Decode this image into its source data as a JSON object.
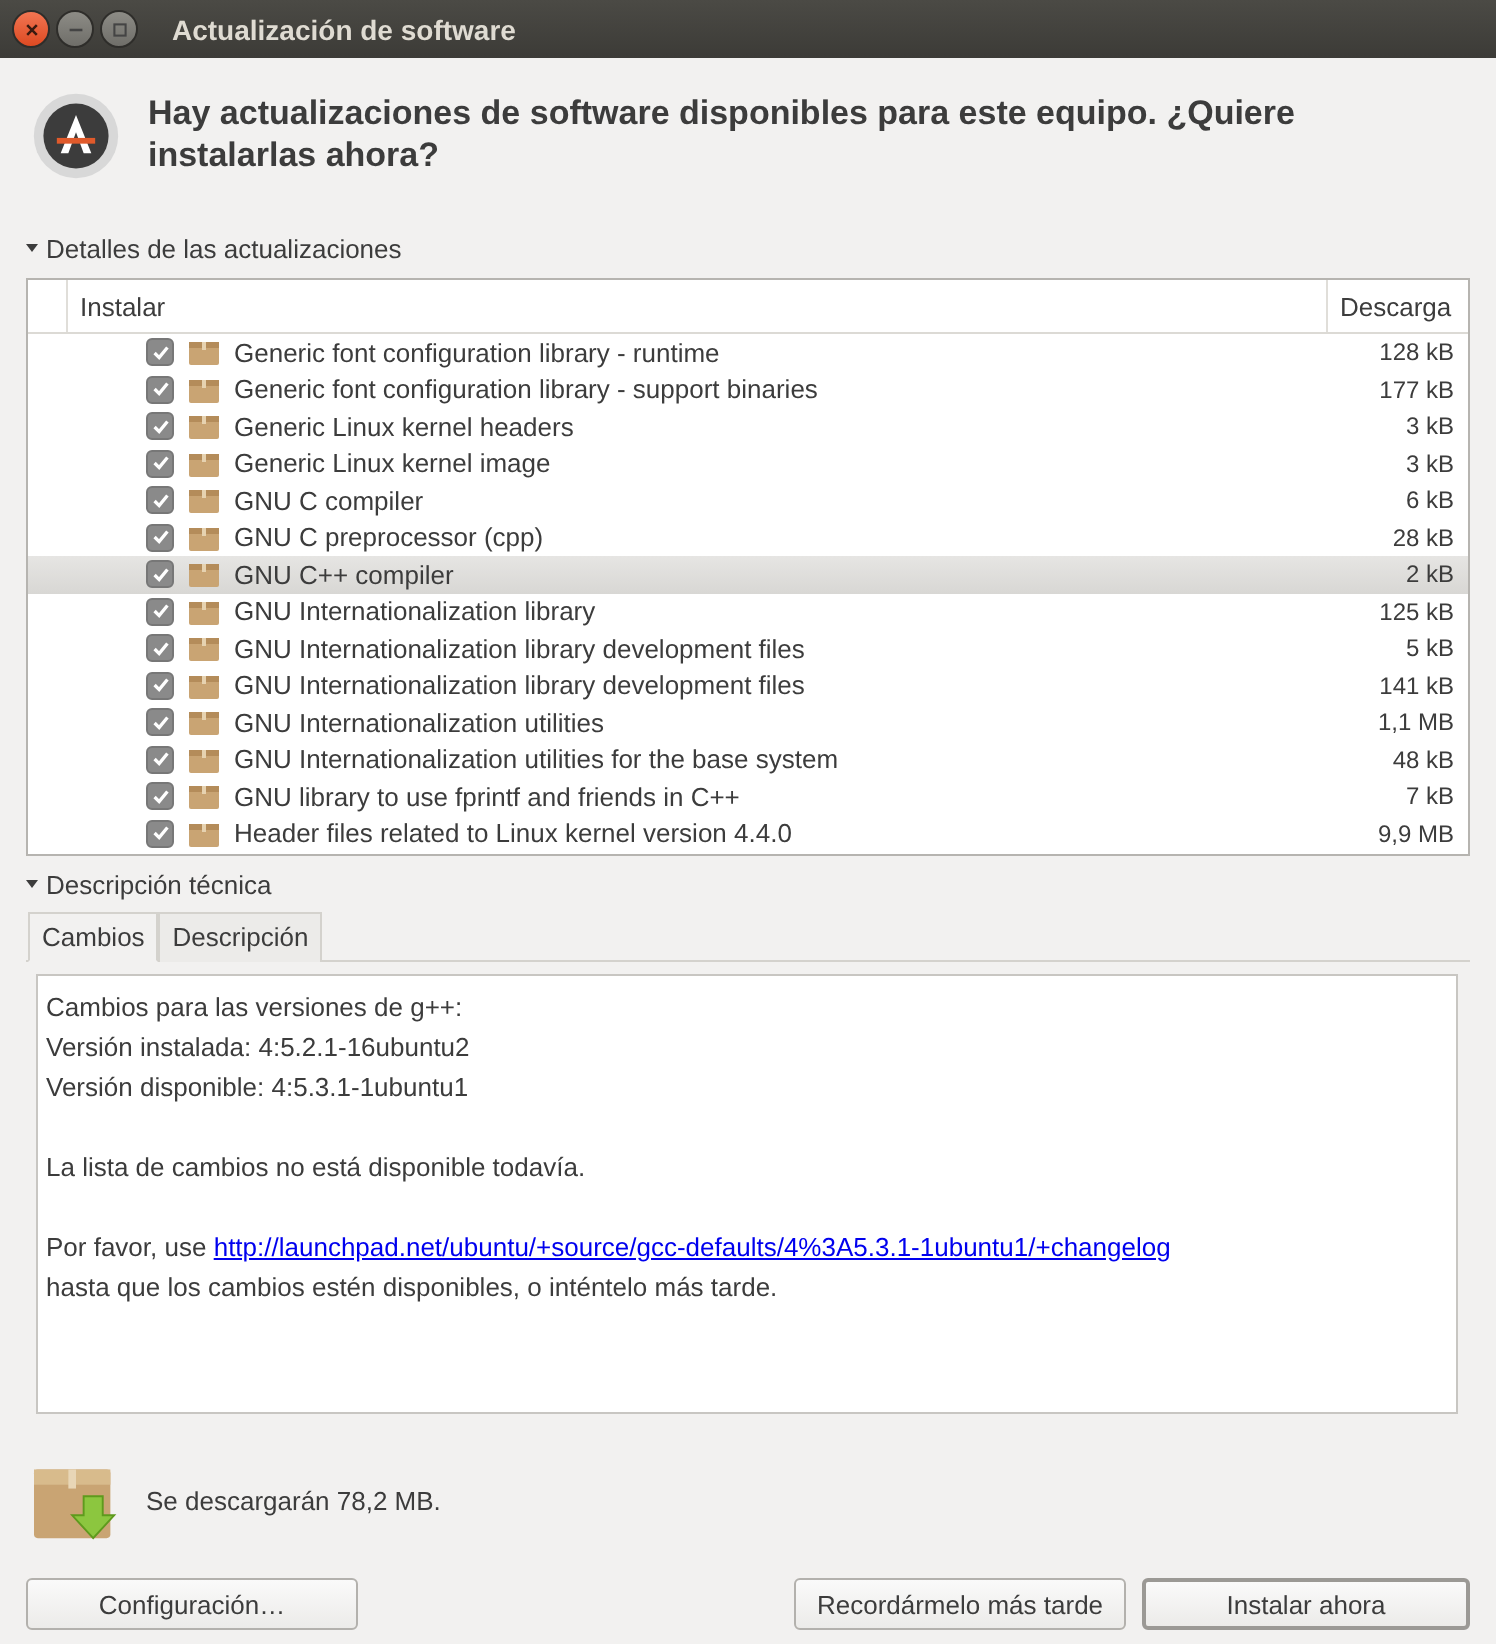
{
  "window": {
    "title": "Actualización de software"
  },
  "heading": "Hay actualizaciones de software disponibles para este equipo. ¿Quiere instalarlas ahora?",
  "details": {
    "label": "Detalles de las actualizaciones",
    "expanded": true
  },
  "table": {
    "columns": [
      "Instalar",
      "Descarga"
    ],
    "rows": [
      {
        "name": "Generic font configuration library - runtime",
        "size": "128 kB",
        "checked": true,
        "selected": false
      },
      {
        "name": "Generic font configuration library - support binaries",
        "size": "177 kB",
        "checked": true,
        "selected": false
      },
      {
        "name": "Generic Linux kernel headers",
        "size": "3 kB",
        "checked": true,
        "selected": false
      },
      {
        "name": "Generic Linux kernel image",
        "size": "3 kB",
        "checked": true,
        "selected": false
      },
      {
        "name": "GNU C compiler",
        "size": "6 kB",
        "checked": true,
        "selected": false
      },
      {
        "name": "GNU C preprocessor (cpp)",
        "size": "28 kB",
        "checked": true,
        "selected": false
      },
      {
        "name": "GNU C++ compiler",
        "size": "2 kB",
        "checked": true,
        "selected": true
      },
      {
        "name": "GNU Internationalization library",
        "size": "125 kB",
        "checked": true,
        "selected": false
      },
      {
        "name": "GNU Internationalization library development files",
        "size": "5 kB",
        "checked": true,
        "selected": false
      },
      {
        "name": "GNU Internationalization library development files",
        "size": "141 kB",
        "checked": true,
        "selected": false
      },
      {
        "name": "GNU Internationalization utilities",
        "size": "1,1 MB",
        "checked": true,
        "selected": false
      },
      {
        "name": "GNU Internationalization utilities for the base system",
        "size": "48 kB",
        "checked": true,
        "selected": false
      },
      {
        "name": "GNU library to use fprintf and friends in C++",
        "size": "7 kB",
        "checked": true,
        "selected": false
      },
      {
        "name": "Header files related to Linux kernel version 4.4.0",
        "size": "9,9 MB",
        "checked": true,
        "selected": false
      }
    ]
  },
  "technical": {
    "label": "Descripción técnica",
    "expanded": true
  },
  "tabs": [
    {
      "label": "Cambios",
      "selected": true
    },
    {
      "label": "Descripción",
      "selected": false
    }
  ],
  "changes": {
    "paragraphs": [
      [
        "Cambios para las versiones de g++:",
        "Versión instalada: 4:5.2.1-16ubuntu2",
        "Versión disponible: 4:5.3.1-1ubuntu1"
      ],
      [
        "La lista de cambios no está disponible todavía."
      ]
    ],
    "link_prefix": "Por favor, use",
    "link": "http://launchpad.net/ubuntu/+source/gcc-defaults/4%3A5.3.1-1ubuntu1/+changelog",
    "after": "hasta que los cambios estén disponibles, o inténtelo más tarde."
  },
  "download_note": "Se descargarán 78,2 MB.",
  "buttons": [
    {
      "label": "Configuración…",
      "default": false
    },
    {
      "label": "Recordármelo más tarde",
      "default": false
    },
    {
      "label": "Instalar ahora",
      "default": true
    }
  ]
}
